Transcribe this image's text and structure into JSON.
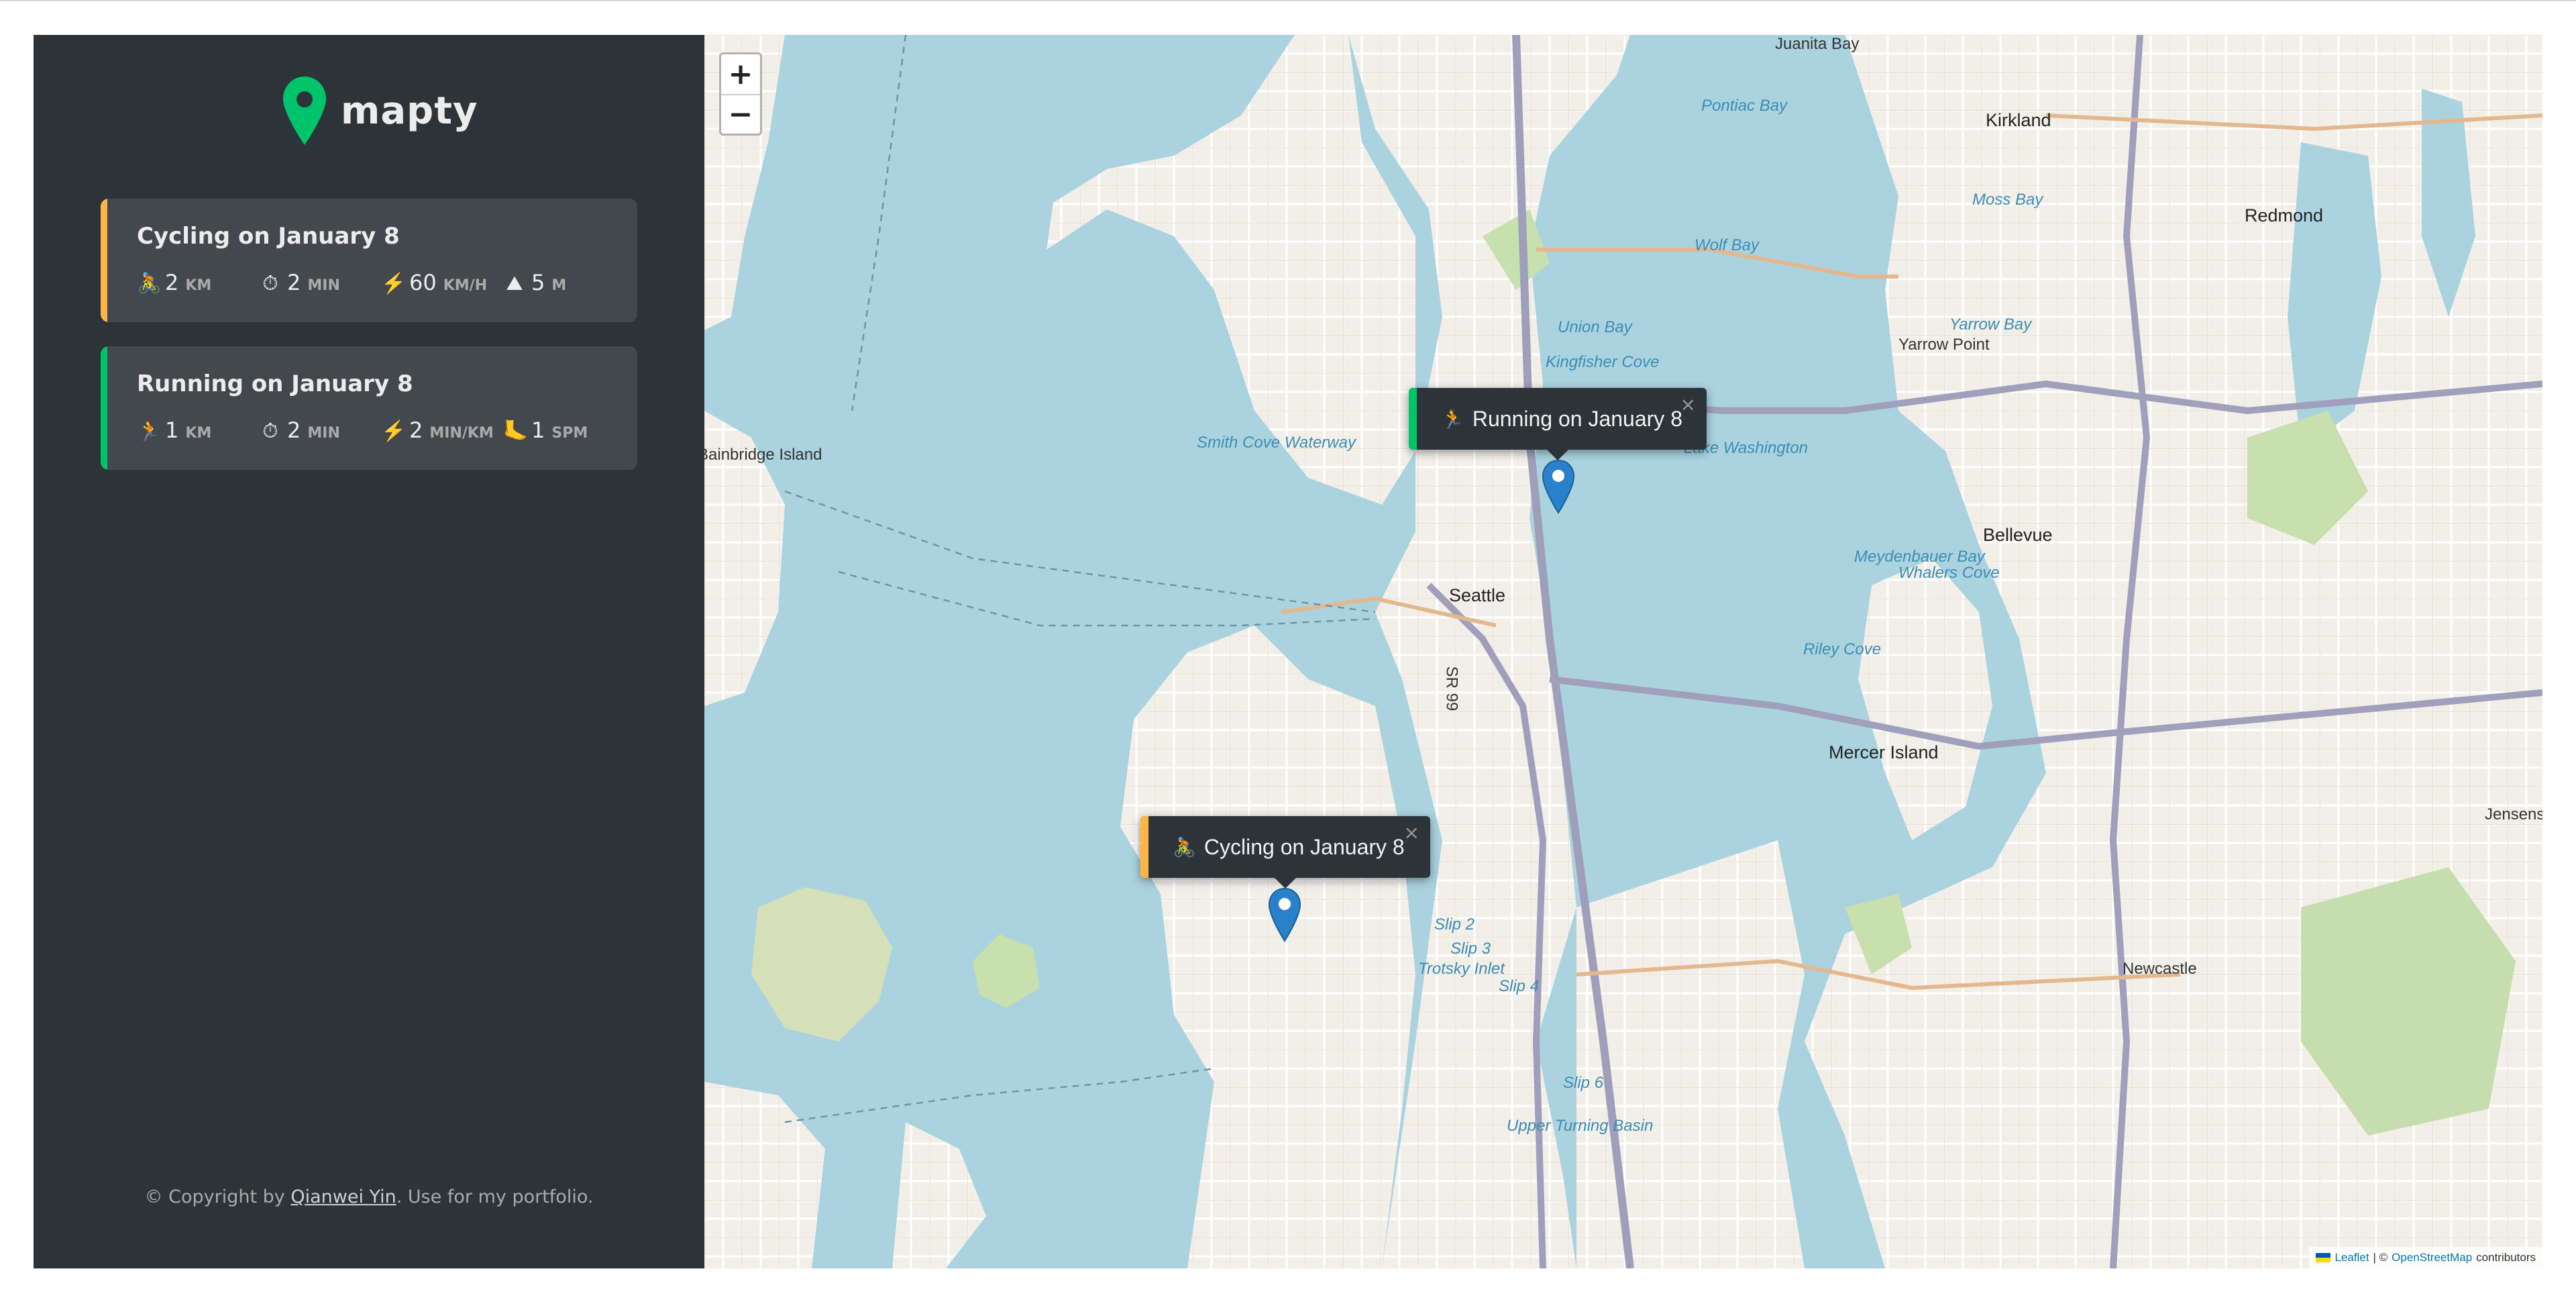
{
  "app": {
    "name": "mapty",
    "logo_icon": "map-pin-icon",
    "accent_green": "#00c46a",
    "accent_orange": "#ffb545"
  },
  "workouts": [
    {
      "type": "cycling",
      "title": "Cycling on January 8",
      "color": "#ffb545",
      "details": [
        {
          "icon": "cyclist-icon",
          "glyph": "🚴",
          "value": "2",
          "unit": "km"
        },
        {
          "icon": "stopwatch-icon",
          "glyph": "⏱",
          "value": "2",
          "unit": "min"
        },
        {
          "icon": "lightning-icon",
          "glyph": "⚡",
          "value": "60",
          "unit": "km/h"
        },
        {
          "icon": "mountain-icon",
          "glyph": "⛰",
          "value": "5",
          "unit": "m"
        }
      ]
    },
    {
      "type": "running",
      "title": "Running on January 8",
      "color": "#00c46a",
      "details": [
        {
          "icon": "runner-icon",
          "glyph": "🏃",
          "value": "1",
          "unit": "km"
        },
        {
          "icon": "stopwatch-icon",
          "glyph": "⏱",
          "value": "2",
          "unit": "min"
        },
        {
          "icon": "lightning-icon",
          "glyph": "⚡",
          "value": "2",
          "unit": "min/km"
        },
        {
          "icon": "footprint-icon",
          "glyph": "🦶",
          "value": "1",
          "unit": "spm"
        }
      ]
    }
  ],
  "copyright": {
    "prefix": "© Copyright by ",
    "author": "Qianwei Yin",
    "suffix": ". Use for my portfolio."
  },
  "map": {
    "zoom_in": "+",
    "zoom_out": "−",
    "popups": [
      {
        "text": "Running on January 8",
        "glyph": "🏃",
        "color": "#00c46a",
        "close": "×"
      },
      {
        "text": "Cycling on January 8",
        "glyph": "🚴",
        "color": "#ffb545",
        "close": "×"
      }
    ],
    "places": {
      "juanita_bay": "Juanita Bay",
      "kirkland": "Kirkland",
      "pontiac_bay": "Pontiac Bay",
      "moss_bay": "Moss Bay",
      "redmond": "Redmond",
      "wolf_bay": "Wolf Bay",
      "union_bay": "Union Bay",
      "yarrow_bay": "Yarrow Bay",
      "yarrow_point": "Yarrow Point",
      "kingfisher_cove": "Kingfisher Cove",
      "lake_washington": "Lake Washington",
      "smith_cove": "Smith Cove Waterway",
      "bainbridge_island": "Bainbridge Island",
      "bellevue": "Bellevue",
      "meydenbauer_bay": "Meydenbauer Bay",
      "whalers_cove": "Whalers Cove",
      "seattle": "Seattle",
      "riley_cove": "Riley Cove",
      "mercer_island": "Mercer Island",
      "jensens": "Jensens",
      "sr99": "SR 99",
      "slip2": "Slip 2",
      "slip3": "Slip 3",
      "trotsky_inlet": "Trotsky Inlet",
      "slip4": "Slip 4",
      "newcastle": "Newcastle",
      "slip6": "Slip 6",
      "upper_turning_basin": "Upper Turning Basin"
    },
    "attribution": {
      "leaflet": "Leaflet",
      "separator": " | © ",
      "osm": "OpenStreetMap",
      "suffix": " contributors"
    }
  }
}
